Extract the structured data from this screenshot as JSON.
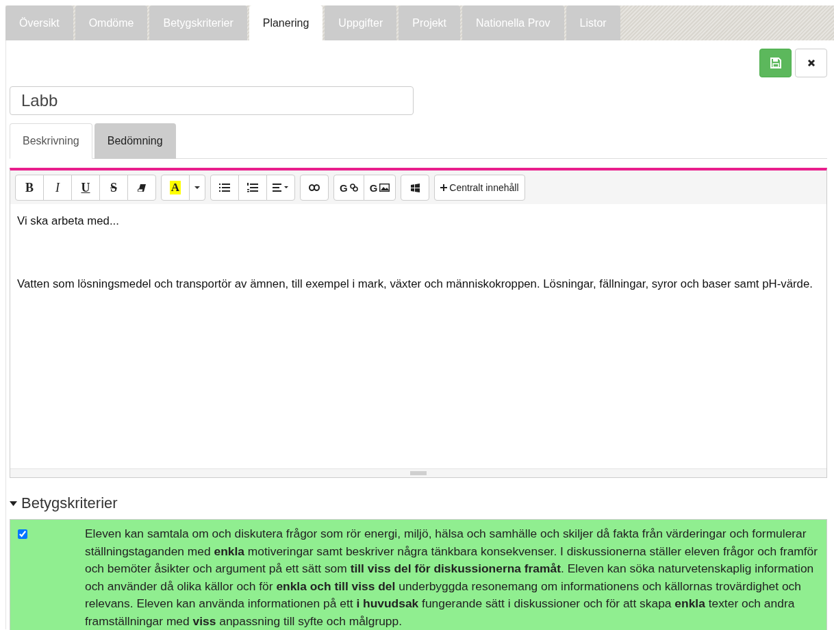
{
  "tabs": [
    {
      "label": "Översikt",
      "selected": false
    },
    {
      "label": "Omdöme",
      "selected": false
    },
    {
      "label": "Betygskriterier",
      "selected": false
    },
    {
      "label": "Planering",
      "selected": true
    },
    {
      "label": "Uppgifter",
      "selected": false
    },
    {
      "label": "Projekt",
      "selected": false
    },
    {
      "label": "Nationella Prov",
      "selected": false
    },
    {
      "label": "Listor",
      "selected": false
    }
  ],
  "title_field": {
    "value": "Labb"
  },
  "subtabs": [
    {
      "label": "Beskrivning",
      "selected": true
    },
    {
      "label": "Bedömning",
      "selected": false
    }
  ],
  "toolbar": [
    [
      {
        "kind": "bold",
        "label": "B"
      },
      {
        "kind": "italic",
        "label": "I"
      },
      {
        "kind": "underline",
        "label": "U"
      },
      {
        "kind": "strike",
        "label": "S"
      },
      {
        "kind": "eraser"
      }
    ],
    [
      {
        "kind": "highlight",
        "label": "A"
      },
      {
        "kind": "caret"
      }
    ],
    [
      {
        "kind": "bullets"
      },
      {
        "kind": "numbers"
      },
      {
        "kind": "align"
      }
    ],
    [
      {
        "kind": "link"
      }
    ],
    [
      {
        "kind": "glink",
        "label": "G"
      },
      {
        "kind": "gimage",
        "label": "G"
      }
    ],
    [
      {
        "kind": "windows"
      }
    ],
    [
      {
        "kind": "plus",
        "label": "Centralt innehåll"
      }
    ]
  ],
  "editor": {
    "paragraphs": [
      "Vi ska arbeta med...",
      "Vatten som lösningsmedel och transportör av ämnen, till exempel i mark, växter och människokroppen. Lösningar, fällningar, syror och baser samt pH-värde."
    ]
  },
  "criteria_section": {
    "title": "Betygskriterier",
    "expanded": true,
    "items": [
      {
        "checked": true,
        "text": "Eleven kan samtala om och diskutera frågor som rör energi, miljö, hälsa och samhälle och skiljer då fakta från värderingar och formulerar ställningstaganden med **enkla** motiveringar samt beskriver några tänkbara konsekvenser. I diskussionerna ställer eleven frågor och framför och bemöter åsikter och argument på ett sätt som **till viss del för diskussionerna framåt**. Eleven kan söka naturvetenskaplig information och använder då olika källor och för **enkla och till viss del** underbyggda resonemang om informationens och källornas trovärdighet och relevans. Eleven kan använda informationen på ett **i huvudsak** fungerande sätt i diskussioner och för att skapa **enkla** texter och andra framställningar med **viss** anpassning till syfte och målgrupp."
      }
    ]
  }
}
